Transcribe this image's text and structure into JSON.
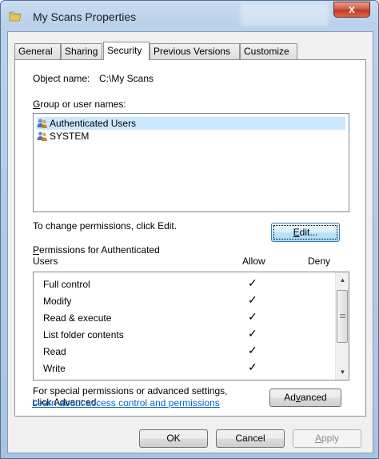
{
  "window": {
    "title": "My Scans Properties",
    "close_glyph": "x"
  },
  "tabs": [
    {
      "label": "General",
      "active": false
    },
    {
      "label": "Sharing",
      "active": false
    },
    {
      "label": "Security",
      "active": true
    },
    {
      "label": "Previous Versions",
      "active": false
    },
    {
      "label": "Customize",
      "active": false
    }
  ],
  "security": {
    "object_name_label": "Object name:",
    "object_name_value": "C:\\My Scans",
    "group_label": "Group or user names:",
    "group_label_accel": "G",
    "group_label_rest": "roup or user names:",
    "users": [
      {
        "name": "Authenticated Users",
        "selected": true,
        "icon": "users-icon"
      },
      {
        "name": "SYSTEM",
        "selected": false,
        "icon": "users-icon"
      }
    ],
    "change_hint": "To change permissions, click Edit.",
    "edit_button": {
      "accel": "E",
      "rest": "dit..."
    },
    "permissions_label_accel": "P",
    "permissions_label_line1_rest": "ermissions for Authenticated",
    "permissions_label_line2": "Users",
    "allow_header": "Allow",
    "deny_header": "Deny",
    "permissions": [
      {
        "name": "Full control",
        "allow": true,
        "deny": false
      },
      {
        "name": "Modify",
        "allow": true,
        "deny": false
      },
      {
        "name": "Read & execute",
        "allow": true,
        "deny": false
      },
      {
        "name": "List folder contents",
        "allow": true,
        "deny": false
      },
      {
        "name": "Read",
        "allow": true,
        "deny": false
      },
      {
        "name": "Write",
        "allow": true,
        "deny": false
      }
    ],
    "check_glyph": "✓",
    "special_hint_line1": "For special permissions or advanced settings,",
    "special_hint_line2": "click Advanced.",
    "advanced_button": {
      "pre": "Ad",
      "accel": "v",
      "post": "anced"
    },
    "learn_link": "Learn about access control and permissions"
  },
  "footer": {
    "ok": "OK",
    "cancel": "Cancel",
    "apply_accel": "A",
    "apply_rest": "pply"
  },
  "colors": {
    "link": "#0066cc",
    "selection": "#cce8ff"
  }
}
